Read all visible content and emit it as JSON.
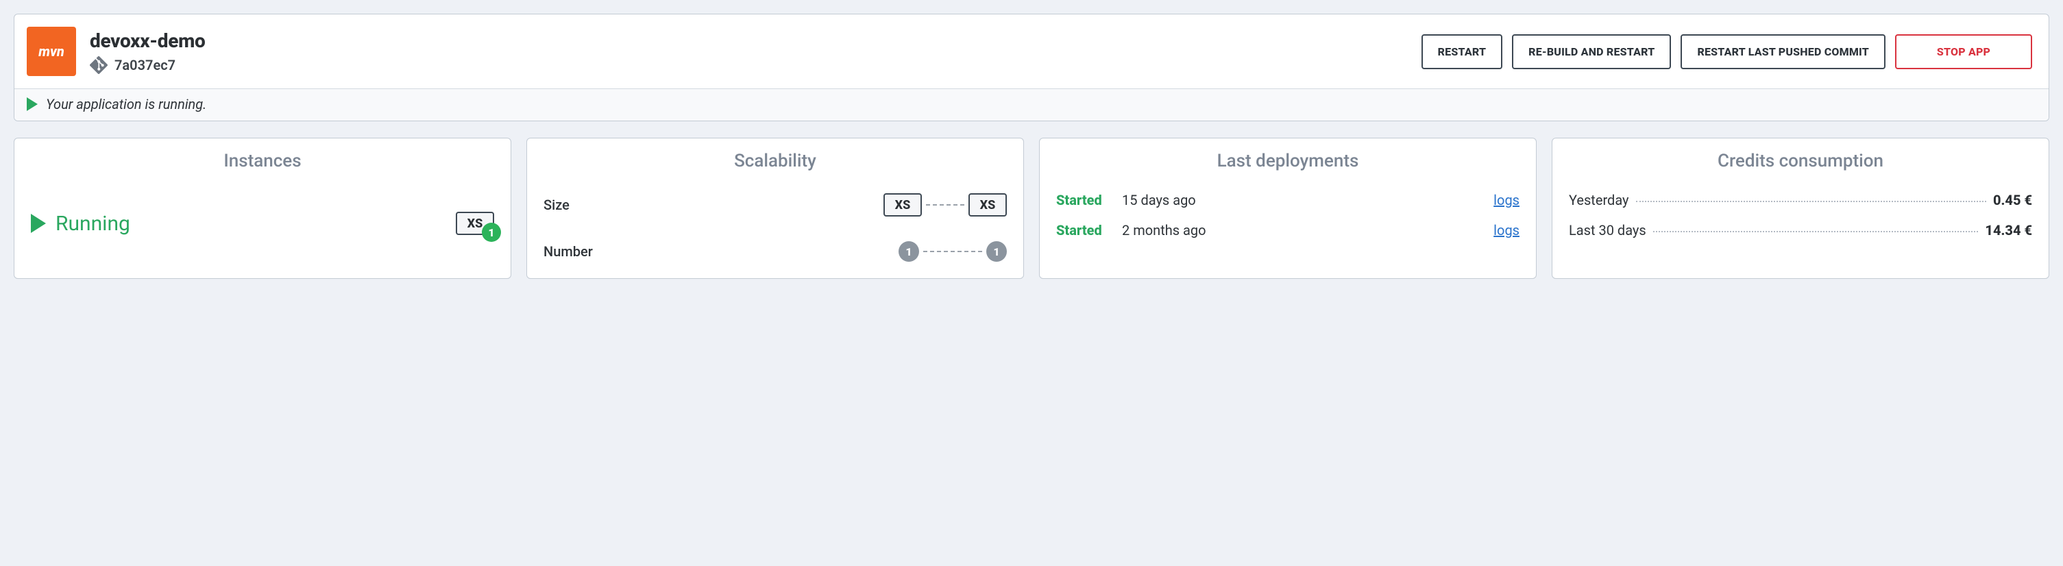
{
  "header": {
    "app_name": "devoxx-demo",
    "commit_id": "7a037ec7",
    "logo_text": "mvn",
    "buttons": {
      "restart": "RESTART",
      "rebuild": "RE-BUILD AND RESTART",
      "restart_last": "RESTART LAST PUSHED COMMIT",
      "stop": "STOP APP"
    },
    "status_message": "Your application is running."
  },
  "cards": {
    "instances": {
      "title": "Instances",
      "state": "Running",
      "size": "XS",
      "count": "1"
    },
    "scalability": {
      "title": "Scalability",
      "size_label": "Size",
      "size_min": "XS",
      "size_max": "XS",
      "number_label": "Number",
      "number_min": "1",
      "number_max": "1"
    },
    "deployments": {
      "title": "Last deployments",
      "rows": [
        {
          "status": "Started",
          "time": "15 days ago",
          "link": "logs"
        },
        {
          "status": "Started",
          "time": "2 months ago",
          "link": "logs"
        }
      ]
    },
    "credits": {
      "title": "Credits consumption",
      "rows": [
        {
          "label": "Yesterday",
          "value": "0.45 €"
        },
        {
          "label": "Last 30 days",
          "value": "14.34 €"
        }
      ]
    }
  }
}
